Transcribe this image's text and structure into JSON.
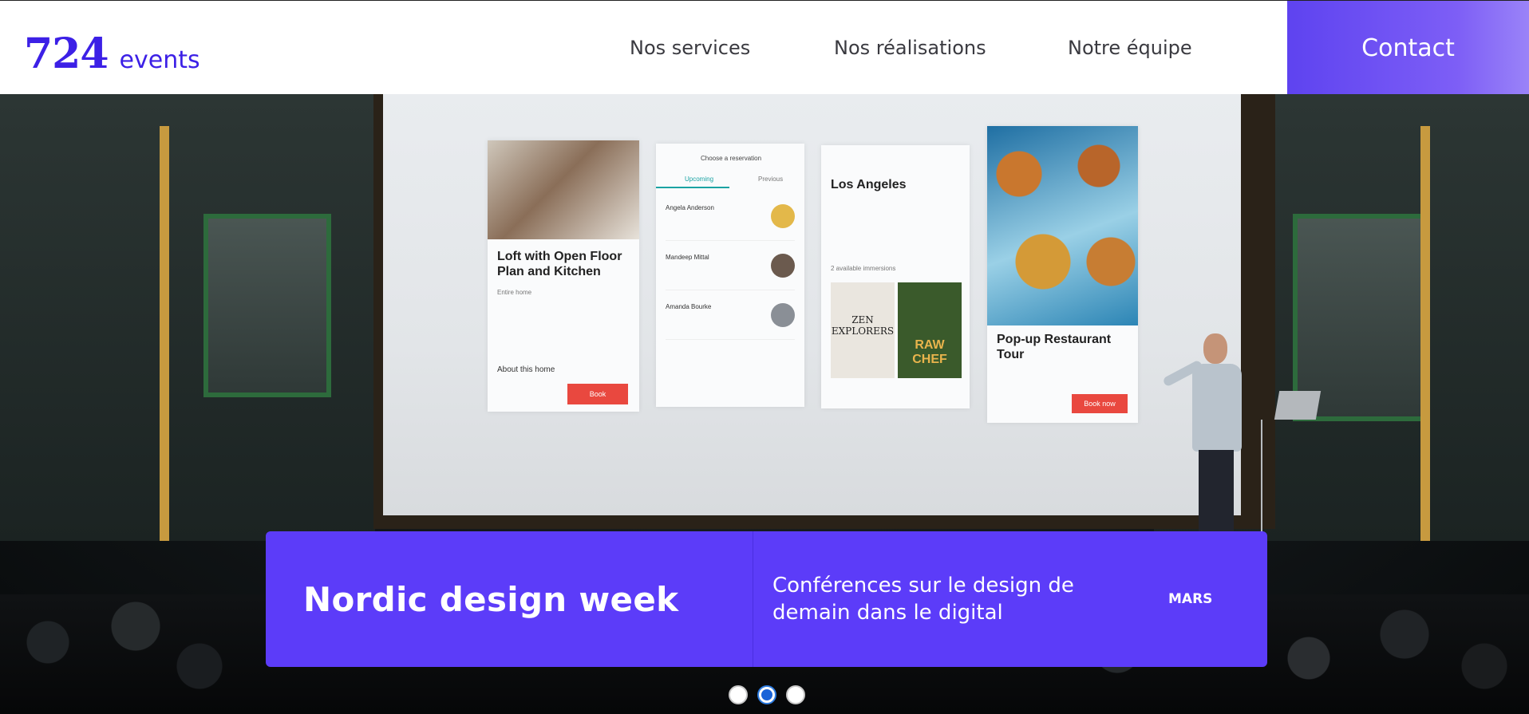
{
  "header": {
    "logo_number": "724",
    "logo_word": "events",
    "nav": [
      {
        "label": "Nos services"
      },
      {
        "label": "Nos réalisations"
      },
      {
        "label": "Notre équipe"
      }
    ],
    "contact_label": "Contact"
  },
  "hero": {
    "screen_cards": {
      "card1_title": "Loft with Open Floor Plan and Kitchen",
      "card1_sub": "Entire home",
      "card1_book": "Book",
      "card1_about": "About this home",
      "card2_title": "Choose a reservation",
      "card2_tab1": "Upcoming",
      "card2_tab2": "Previous",
      "card2_rows": [
        "Angela Anderson",
        "Mandeep Mittal",
        "Amanda Bourke"
      ],
      "card3_title": "Los Angeles",
      "card3_sub": "2 available immersions",
      "card3_book1": "ZEN EXPLORERS",
      "card3_book2": "RAW CHEF",
      "card4_title": "Pop-up Restaurant Tour",
      "card4_book": "Book now"
    },
    "event": {
      "title": "Nordic design week",
      "description": "Conférences sur le design de demain dans le digital",
      "month": "MARS"
    }
  },
  "pagination": {
    "count": 3,
    "active_index": 1
  },
  "colors": {
    "brand": "#3c20e6",
    "event_card": "#5c3cf9",
    "contact_gradient_start": "#5e43f0",
    "contact_gradient_end": "#9a83f8",
    "active_dot": "#1a63d8"
  }
}
